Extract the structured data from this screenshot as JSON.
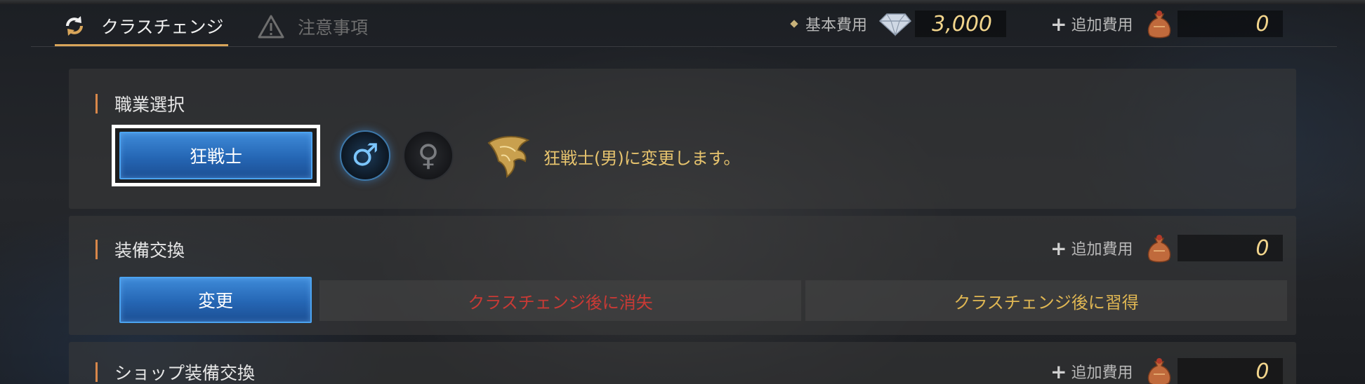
{
  "tabs": [
    {
      "label": "クラスチェンジ",
      "icon": "refresh-icon",
      "active": true
    },
    {
      "label": "注意事項",
      "icon": "warning-icon",
      "active": false
    }
  ],
  "header": {
    "base_cost_label": "基本費用",
    "base_cost_value": "3,000",
    "base_cost_icon": "diamond-gem-icon",
    "extra_cost_label": "追加費用",
    "extra_cost_value": "0",
    "extra_cost_icon": "money-bag-icon"
  },
  "job_section": {
    "title": "職業選択",
    "selected_class": "狂戦士",
    "male_symbol": "♂",
    "female_symbol": "♀",
    "class_emblem_icon": "berserker-emblem-icon",
    "info_text": "狂戦士(男)に変更します。"
  },
  "equip_section": {
    "title": "装備交換",
    "extra_cost_label": "追加費用",
    "extra_cost_value": "0",
    "change_button": "変更",
    "lost_label": "クラスチェンジ後に消失",
    "learn_label": "クラスチェンジ後に習得"
  },
  "shop_section": {
    "title": "ショップ装備交換",
    "extra_cost_label": "追加費用",
    "extra_cost_value": "0"
  },
  "colors": {
    "accent_gold": "#e7c46e",
    "lost_red": "#c93a35",
    "learn_gold": "#e0b753",
    "button_blue": "#2566b4"
  }
}
